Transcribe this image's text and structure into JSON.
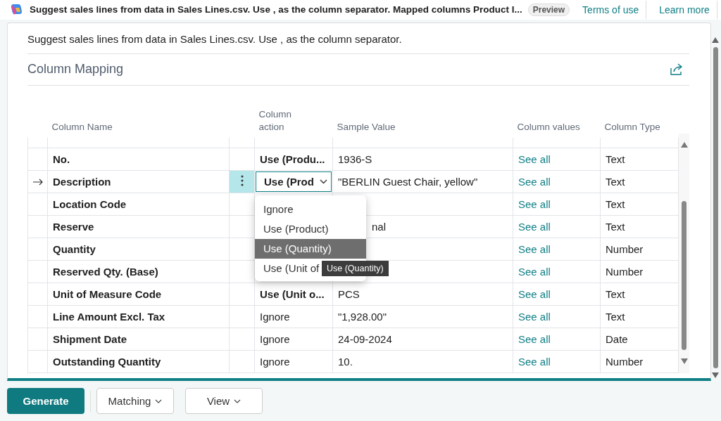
{
  "header": {
    "title": "Suggest sales lines from data in Sales Lines.csv. Use , as the column separator. Mapped columns Product I...",
    "badge": "Preview",
    "links": [
      "Terms of use",
      "Learn more"
    ]
  },
  "description": "Suggest sales lines from data in Sales Lines.csv. Use , as the column separator.",
  "section": {
    "title": "Column Mapping"
  },
  "table": {
    "columns": [
      "Column Name",
      "Column action",
      "Sample Value",
      "Column values",
      "Column Type"
    ],
    "rows": [
      {
        "name": "No.",
        "action": "Use (Produ...",
        "mapped": true,
        "sample": "1936-S",
        "values": "See all",
        "type": "Text",
        "selected": false
      },
      {
        "name": "Description",
        "action": "Use (Prod",
        "mapped": true,
        "sample": "\"BERLIN Guest Chair, yellow\"",
        "values": "See all",
        "type": "Text",
        "selected": true
      },
      {
        "name": "Location Code",
        "action": "",
        "sample": "",
        "values": "See all",
        "type": "Text",
        "selected": false
      },
      {
        "name": "Reserve",
        "action": "",
        "sample": "nal",
        "values": "See all",
        "type": "Text",
        "selected": false
      },
      {
        "name": "Quantity",
        "action": "",
        "sample": "",
        "values": "See all",
        "type": "Number",
        "selected": false
      },
      {
        "name": "Reserved Qty. (Base)",
        "action": "",
        "sample": "",
        "values": "See all",
        "type": "Number",
        "selected": false
      },
      {
        "name": "Unit of Measure Code",
        "action": "Use (Unit o...",
        "mapped": true,
        "sample": "PCS",
        "values": "See all",
        "type": "Text",
        "selected": false
      },
      {
        "name": "Line Amount Excl. Tax",
        "action": "Ignore",
        "mapped": false,
        "sample": "\"1,928.00\"",
        "values": "See all",
        "type": "Text",
        "selected": false
      },
      {
        "name": "Shipment Date",
        "action": "Ignore",
        "mapped": false,
        "sample": "24-09-2024",
        "values": "See all",
        "type": "Date",
        "selected": false
      },
      {
        "name": "Outstanding Quantity",
        "action": "Ignore",
        "mapped": false,
        "sample": "10.",
        "values": "See all",
        "type": "Number",
        "selected": false
      }
    ]
  },
  "dropdown": {
    "options": [
      {
        "label": "Ignore",
        "selected": false
      },
      {
        "label": "Use (Product)",
        "selected": false
      },
      {
        "label": "Use (Quantity)",
        "selected": true
      },
      {
        "label": "Use (Unit of",
        "selected": false
      }
    ],
    "tooltip": "Use (Quantity)"
  },
  "actions": [
    {
      "label": "Generate",
      "kind": "primary"
    },
    {
      "label": "Matching",
      "kind": "menu"
    },
    {
      "label": "View",
      "kind": "menu"
    }
  ]
}
